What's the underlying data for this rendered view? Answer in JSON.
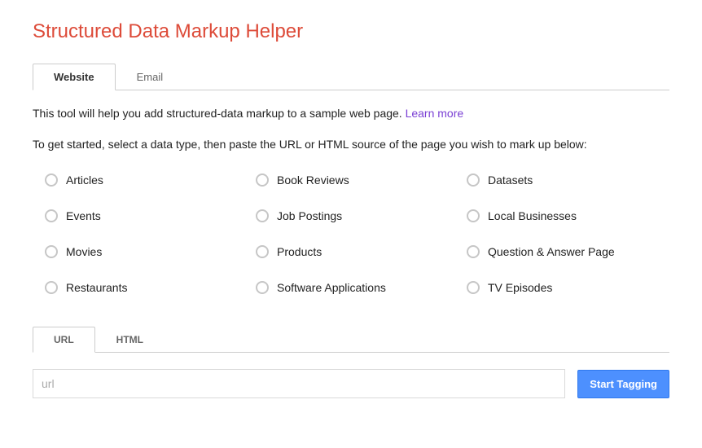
{
  "title": "Structured Data Markup Helper",
  "tabs": {
    "website": "Website",
    "email": "Email"
  },
  "intro": "This tool will help you add structured-data markup to a sample web page. ",
  "learn_more": "Learn more",
  "get_started": "To get started, select a data type, then paste the URL or HTML source of the page you wish to mark up below:",
  "data_types": {
    "articles": "Articles",
    "book_reviews": "Book Reviews",
    "datasets": "Datasets",
    "events": "Events",
    "job_postings": "Job Postings",
    "local_businesses": "Local Businesses",
    "movies": "Movies",
    "products": "Products",
    "qa_page": "Question & Answer Page",
    "restaurants": "Restaurants",
    "software_applications": "Software Applications",
    "tv_episodes": "TV Episodes"
  },
  "input_tabs": {
    "url": "URL",
    "html": "HTML"
  },
  "url_placeholder": "url",
  "start_button": "Start Tagging"
}
